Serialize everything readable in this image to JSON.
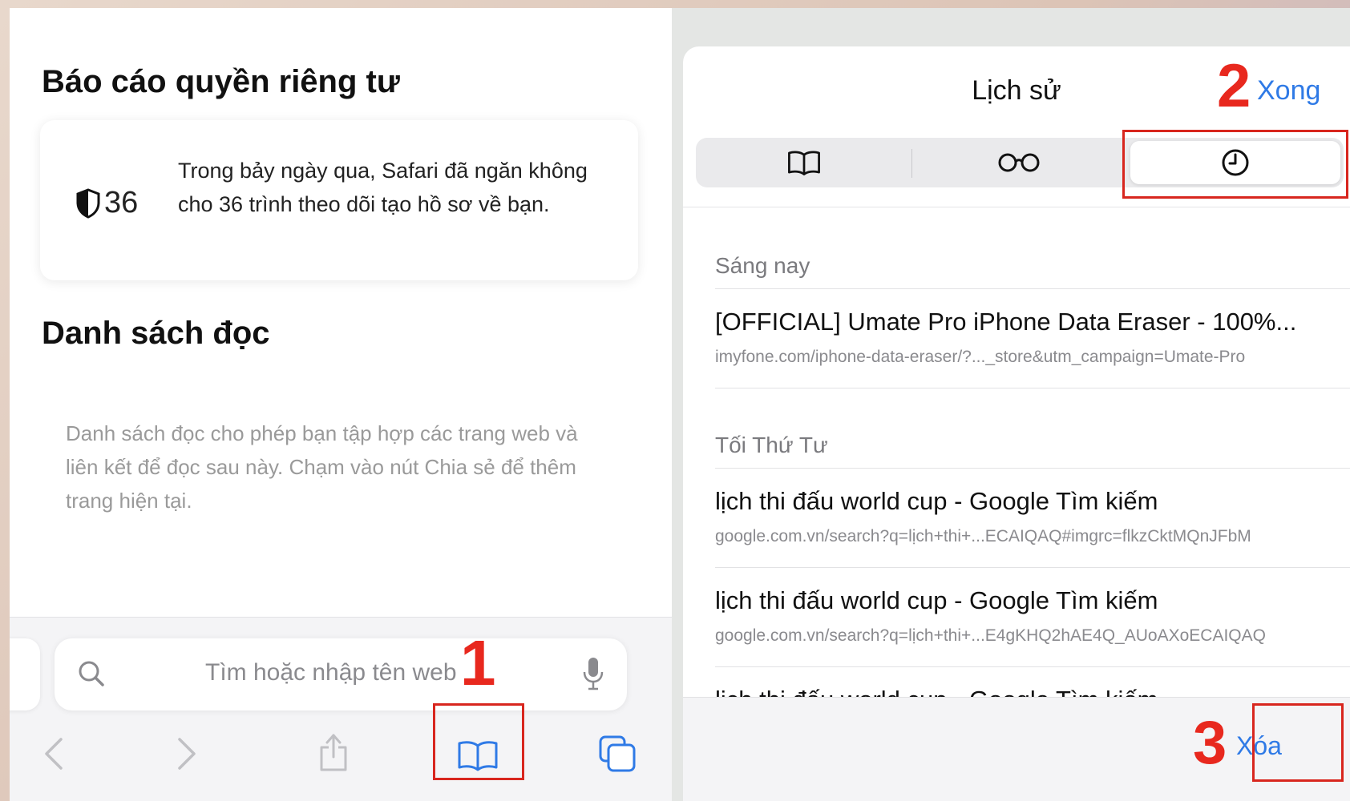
{
  "left": {
    "privacy_title": "Báo cáo quyền riêng tư",
    "privacy_count": "36",
    "privacy_text": "Trong bảy ngày qua, Safari đã ngăn không cho 36 trình theo dõi tạo hồ sơ về bạn.",
    "reading_title": "Danh sách đọc",
    "reading_desc": "Danh sách đọc cho phép bạn tập hợp các trang web và liên kết để đọc sau này. Chạm vào nút Chia sẻ để thêm trang hiện tại.",
    "search_placeholder": "Tìm hoặc nhập tên web",
    "toolbar": [
      "back-icon",
      "forward-icon",
      "share-icon",
      "bookmarks-icon",
      "tabs-icon"
    ]
  },
  "right": {
    "title": "Lịch sử",
    "done_label": "Xong",
    "segments": [
      "bookmarks-icon",
      "reading-list-icon",
      "history-icon"
    ],
    "active_segment": "history-icon",
    "groups": [
      {
        "header": "Sáng nay",
        "items": [
          {
            "title": "[OFFICIAL] Umate Pro iPhone Data Eraser - 100%...",
            "url": "imyfone.com/iphone-data-eraser/?..._store&utm_campaign=Umate-Pro"
          }
        ]
      },
      {
        "header": "Tối Thứ Tư",
        "items": [
          {
            "title": "lịch thi đấu world cup - Google Tìm kiếm",
            "url": "google.com.vn/search?q=lịch+thi+...ECAIQAQ#imgrc=flkzCktMQnJFbM"
          },
          {
            "title": "lịch thi đấu world cup - Google Tìm kiếm",
            "url": "google.com.vn/search?q=lịch+thi+...E4gKHQ2hAE4Q_AUoAXoECAIQAQ"
          },
          {
            "title": "lịch thi đấu world cup - Google Tìm kiếm",
            "url": ""
          }
        ]
      }
    ],
    "clear_label": "Xóa"
  },
  "step_labels": [
    "1",
    "2",
    "3"
  ],
  "colors": {
    "accent": "#2f7ae6",
    "annotation": "#e8281e"
  }
}
